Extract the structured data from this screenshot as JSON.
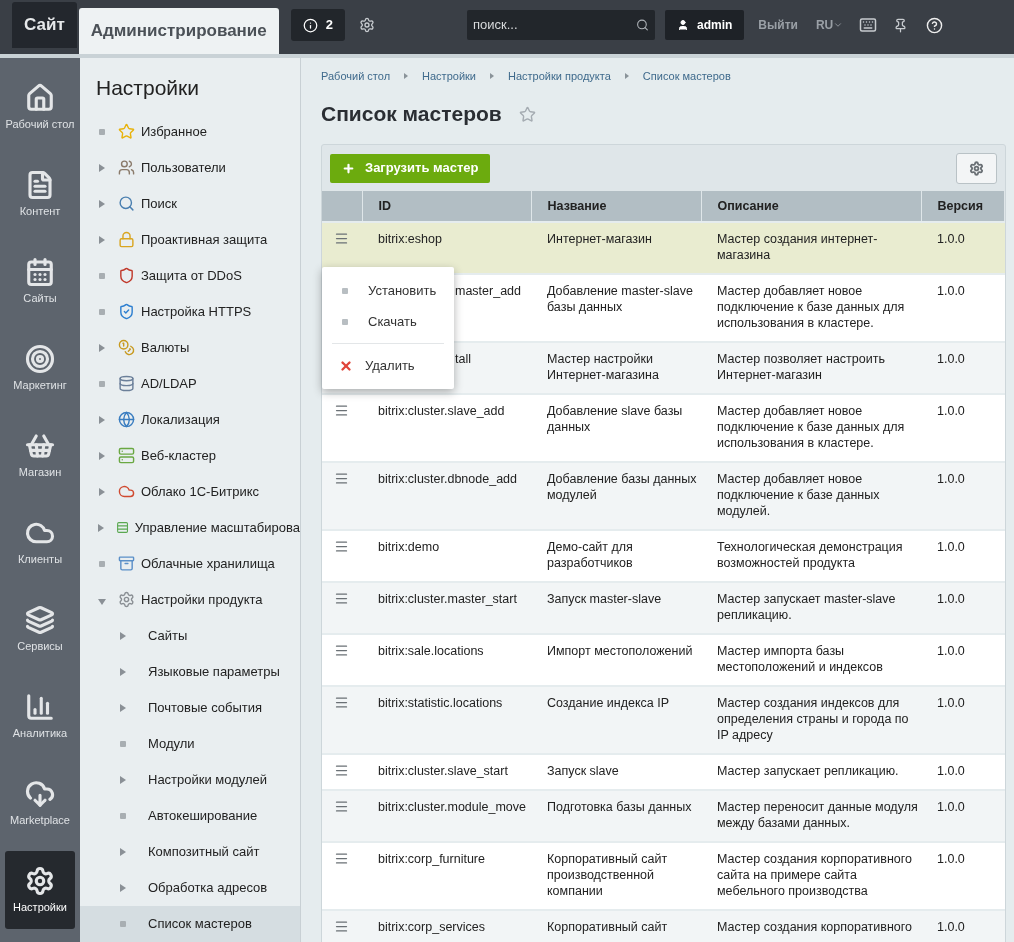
{
  "top_bar": {
    "tabs": [
      {
        "label": "Сайт",
        "selected": false
      },
      {
        "label": "Администрирование",
        "selected": true
      }
    ],
    "notifications": "2",
    "search": {
      "placeholder": "поиск..."
    },
    "user": "admin",
    "logout": "Выйти",
    "language": "RU"
  },
  "left_nav": [
    {
      "label": "Рабочий стол",
      "selected": false
    },
    {
      "label": "Контент",
      "selected": false
    },
    {
      "label": "Сайты",
      "selected": false
    },
    {
      "label": "Маркетинг",
      "selected": false
    },
    {
      "label": "Магазин",
      "selected": false
    },
    {
      "label": "Клиенты",
      "selected": false
    },
    {
      "label": "Сервисы",
      "selected": false
    },
    {
      "label": "Аналитика",
      "selected": false
    },
    {
      "label": "Marketplace",
      "selected": false
    },
    {
      "label": "Настройки",
      "selected": true
    }
  ],
  "menu": {
    "title": "Настройки",
    "items": [
      {
        "label": "Избранное",
        "kind": "leaf",
        "selected": false
      },
      {
        "label": "Пользователи",
        "kind": "folder",
        "selected": false,
        "expanded": false
      },
      {
        "label": "Поиск",
        "kind": "folder",
        "selected": false,
        "expanded": false
      },
      {
        "label": "Проактивная защита",
        "kind": "folder",
        "selected": false,
        "expanded": false
      },
      {
        "label": "Защита от DDoS",
        "kind": "leaf",
        "selected": false
      },
      {
        "label": "Настройка HTTPS",
        "kind": "leaf",
        "selected": false
      },
      {
        "label": "Валюты",
        "kind": "folder",
        "selected": false,
        "expanded": false
      },
      {
        "label": "AD/LDAP",
        "kind": "leaf",
        "selected": false
      },
      {
        "label": "Локализация",
        "kind": "folder",
        "selected": false,
        "expanded": false
      },
      {
        "label": "Веб-кластер",
        "kind": "folder",
        "selected": false,
        "expanded": false
      },
      {
        "label": "Облако 1С-Битрикс",
        "kind": "folder",
        "selected": false,
        "expanded": false
      },
      {
        "label": "Управление масштабирова",
        "kind": "folder",
        "selected": false,
        "expanded": false
      },
      {
        "label": "Облачные хранилища",
        "kind": "leaf",
        "selected": false
      },
      {
        "label": "Настройки продукта",
        "kind": "folder",
        "selected": false,
        "expanded": true,
        "children": [
          {
            "label": "Сайты",
            "kind": "folder",
            "selected": false,
            "expanded": false
          },
          {
            "label": "Языковые параметры",
            "kind": "folder",
            "selected": false,
            "expanded": false
          },
          {
            "label": "Почтовые события",
            "kind": "folder",
            "selected": false,
            "expanded": false
          },
          {
            "label": "Модули",
            "kind": "leaf",
            "selected": false
          },
          {
            "label": "Настройки модулей",
            "kind": "folder",
            "selected": false,
            "expanded": false
          },
          {
            "label": "Автокеширование",
            "kind": "leaf",
            "selected": false
          },
          {
            "label": "Композитный сайт",
            "kind": "folder",
            "selected": false,
            "expanded": false
          },
          {
            "label": "Обработка адресов",
            "kind": "folder",
            "selected": false,
            "expanded": false
          },
          {
            "label": "Список мастеров",
            "kind": "leaf",
            "selected": true
          }
        ]
      }
    ]
  },
  "breadcrumbs": [
    "Рабочий стол",
    "Настройки",
    "Настройки продукта",
    "Список мастеров"
  ],
  "page_title": "Список мастеров",
  "favorite": false,
  "add_button": "Загрузить мастер",
  "table": {
    "columns": [
      "ID",
      "Название",
      "Описание",
      "Версия"
    ],
    "rows": [
      {
        "id": "bitrix:eshop",
        "name": "Интернет-магазин",
        "description": "Мастер создания интернет-магазина",
        "version": "1.0.0",
        "selected": true
      },
      {
        "id": "master_add",
        "covered": true,
        "name": "Добавление master-slave базы данных",
        "description": "Мастер добавляет новое подключение к базе данных для использования в кластере.",
        "version": "1.0.0",
        "selected": false
      },
      {
        "id": "tall",
        "covered": true,
        "name": "Мастер настройки Интернет-магазина",
        "description": "Мастер позволяет настроить Интернет-магазин",
        "version": "1.0.0",
        "selected": false
      },
      {
        "id": "bitrix:cluster.slave_add",
        "name": "Добавление slave базы данных",
        "description": "Мастер добавляет новое подключение к базе данных для использования в кластере.",
        "version": "1.0.0",
        "selected": false
      },
      {
        "id": "bitrix:cluster.dbnode_add",
        "name": "Добавление базы данных модулей",
        "description": "Мастер добавляет новое подключение к базе данных модулей.",
        "version": "1.0.0",
        "selected": false
      },
      {
        "id": "bitrix:demo",
        "name": "Демо-сайт для разработчиков",
        "description": "Технологическая демонстрация возможностей продукта",
        "version": "1.0.0",
        "selected": false
      },
      {
        "id": "bitrix:cluster.master_start",
        "name": "Запуск master-slave",
        "description": "Мастер запускает master-slave репликацию.",
        "version": "1.0.0",
        "selected": false
      },
      {
        "id": "bitrix:sale.locations",
        "name": "Импорт местоположений",
        "description": "Мастер импорта базы местоположений и индексов",
        "version": "1.0.0",
        "selected": false
      },
      {
        "id": "bitrix:statistic.locations",
        "name": "Создание индекса IP",
        "description": "Мастер создания индексов для определения страны и города по IP адресу",
        "version": "1.0.0",
        "selected": false
      },
      {
        "id": "bitrix:cluster.slave_start",
        "name": "Запуск slave",
        "description": "Мастер запускает репликацию.",
        "version": "1.0.0",
        "selected": false
      },
      {
        "id": "bitrix:cluster.module_move",
        "name": "Подготовка базы данных",
        "description": "Мастер переносит данные модуля между базами данных.",
        "version": "1.0.0",
        "selected": false
      },
      {
        "id": "bitrix:corp_furniture",
        "name": "Корпоративный сайт производственной компании",
        "description": "Мастер создания корпоративного сайта на примере сайта мебельного производства",
        "version": "1.0.0",
        "selected": false
      },
      {
        "id": "bitrix:corp_services",
        "name": "Корпоративный сайт",
        "description": "Мастер создания корпоративного",
        "version": "1.0.0",
        "selected": false
      }
    ]
  },
  "context_menu": [
    {
      "label": "Установить",
      "kind": "action"
    },
    {
      "label": "Скачать",
      "kind": "action"
    },
    {
      "label": "Удалить",
      "kind": "delete"
    }
  ]
}
